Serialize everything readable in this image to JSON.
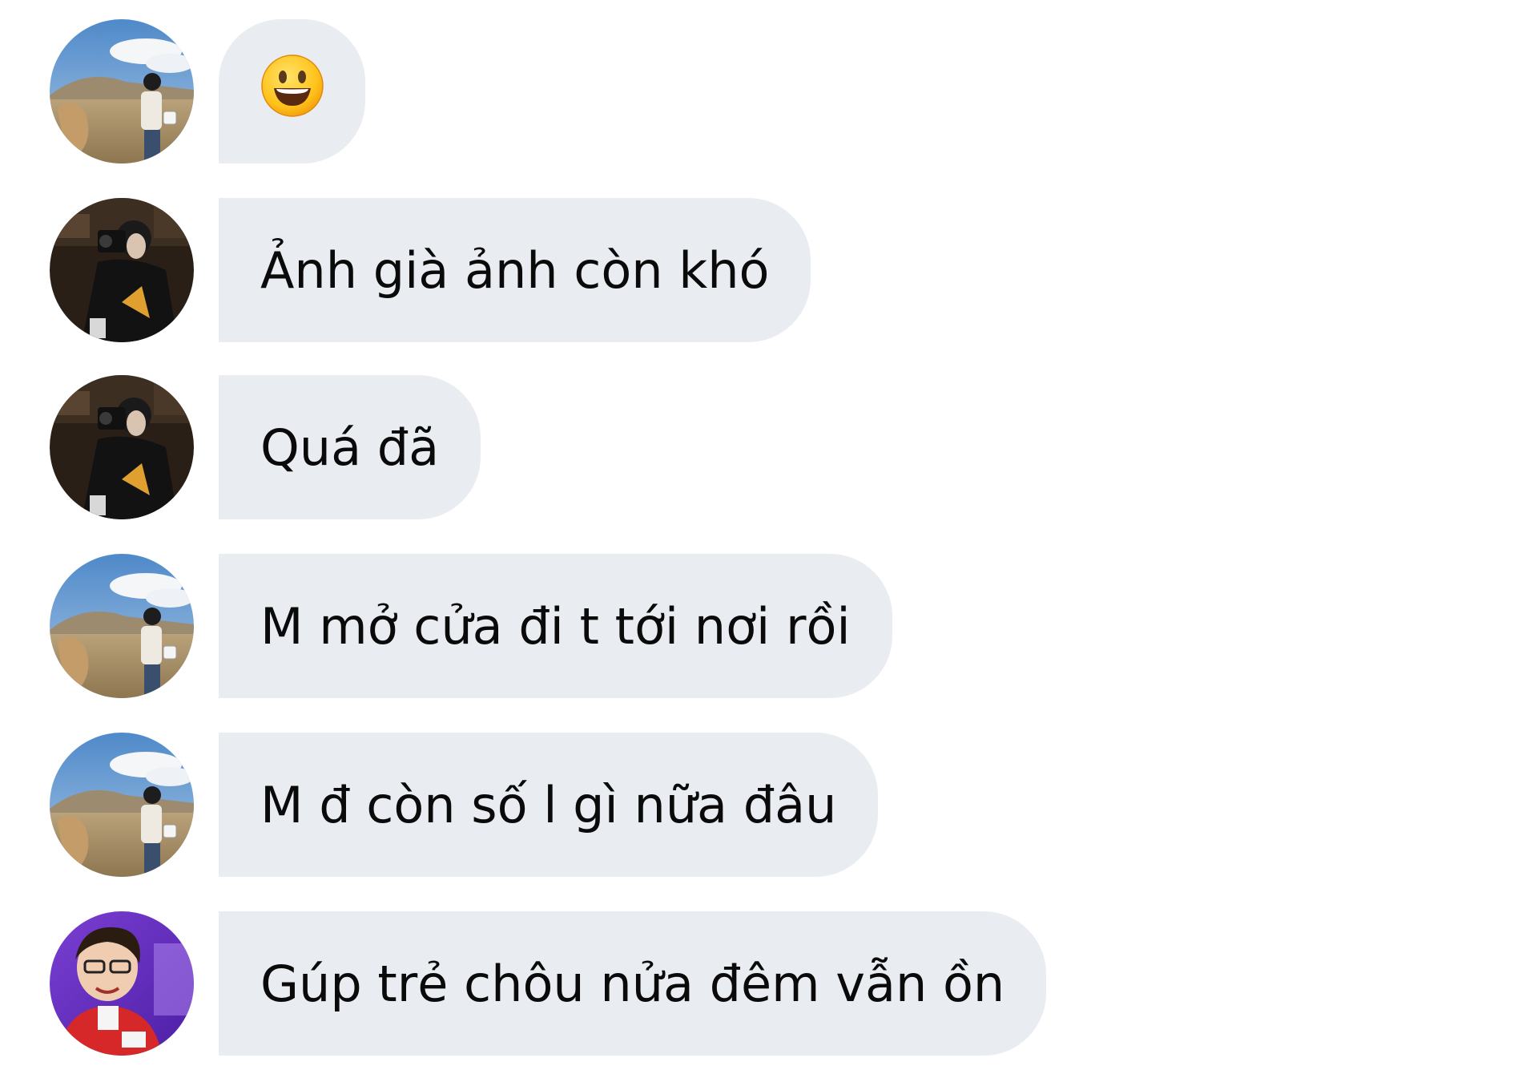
{
  "messages": [
    {
      "avatar": "landscape-photo-avatar",
      "type": "emoji",
      "emoji": "smiling-face-emoji"
    },
    {
      "avatar": "dark-camera-photo-avatar",
      "type": "text",
      "text": "Ảnh già ảnh còn khó"
    },
    {
      "avatar": "dark-camera-photo-avatar",
      "type": "text",
      "text": "Quá đã"
    },
    {
      "avatar": "landscape-photo-avatar",
      "type": "text",
      "text": "M mở cửa đi t tới nơi rồi"
    },
    {
      "avatar": "landscape-photo-avatar",
      "type": "text",
      "text": "M đ còn số l gì nữa đâu"
    },
    {
      "avatar": "purple-portrait-avatar",
      "type": "text",
      "text": "Gúp trẻ chôu nửa đêm vẫn ồn"
    }
  ],
  "colors": {
    "bubble": "#e9ecf0",
    "text": "#0a0a0a",
    "background": "#ffffff"
  }
}
